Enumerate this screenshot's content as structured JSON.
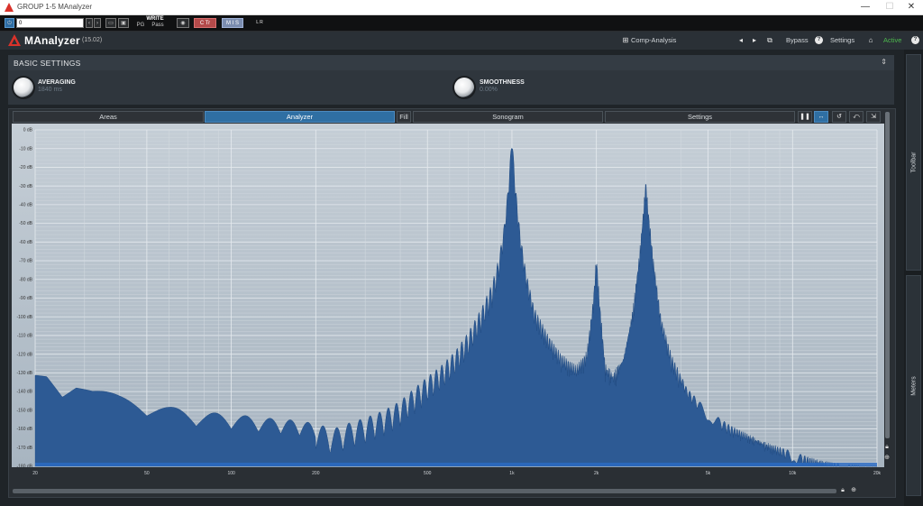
{
  "window": {
    "title": "GROUP 1-5 MAnalyzer",
    "minimize": "—",
    "maximize": "☐",
    "close": "✕"
  },
  "host_toolbar": {
    "preset_value": "0",
    "write_label": "WRITE",
    "pg_label": "PG",
    "pass_label": "Pass",
    "ctr_label": "C Tr",
    "mix_label": "M I S",
    "lr_label": "L R"
  },
  "header": {
    "plugin_name": "MAnalyzer",
    "version": "(15.02)",
    "preset_name": "Comp-Analysis",
    "bypass_label": "Bypass",
    "settings_label": "Settings",
    "active_label": "Active",
    "help_icon": "?",
    "home_icon": "⌂",
    "prev_icon": "◂",
    "next_icon": "▸",
    "random_icon": "⧉",
    "info_icon": "❶",
    "accent_color": "#4db84d"
  },
  "basic_settings": {
    "title": "BASIC SETTINGS",
    "averaging_label": "AVERAGING",
    "averaging_value": "1840 ms",
    "smoothness_label": "SMOOTHNESS",
    "smoothness_value": "0.00%"
  },
  "analyzer_tabs": {
    "areas": "Areas",
    "analyzer": "Analyzer",
    "fill": "Fill",
    "sonogram": "Sonogram",
    "settings": "Settings"
  },
  "analyzer_tools": {
    "pause": "❚❚",
    "range": "↔",
    "reset": "↺",
    "undo": "⤺",
    "export": "⇲"
  },
  "side_panel": {
    "toolbar_label": "Toolbar",
    "meters_label": "Meters"
  },
  "chart_data": {
    "type": "area",
    "x_scale": "log",
    "xlim": [
      20,
      20000
    ],
    "ylim": [
      -180,
      0
    ],
    "y_ticks": [
      "0 dB",
      "-10 dB",
      "-20 dB",
      "-30 dB",
      "-40 dB",
      "-50 dB",
      "-60 dB",
      "-70 dB",
      "-80 dB",
      "-90 dB",
      "-100 dB",
      "-110 dB",
      "-120 dB",
      "-130 dB",
      "-140 dB",
      "-150 dB",
      "-160 dB",
      "-170 dB",
      "-180 dB"
    ],
    "x_ticks": [
      {
        "freq": 20,
        "label": "20"
      },
      {
        "freq": 50,
        "label": "50"
      },
      {
        "freq": 100,
        "label": "100"
      },
      {
        "freq": 200,
        "label": "200"
      },
      {
        "freq": 500,
        "label": "500"
      },
      {
        "freq": 1000,
        "label": "1k"
      },
      {
        "freq": 2000,
        "label": "2k"
      },
      {
        "freq": 5000,
        "label": "5k"
      },
      {
        "freq": 10000,
        "label": "10k"
      },
      {
        "freq": 20000,
        "label": "20k"
      }
    ],
    "peaks": [
      {
        "freq": 1000,
        "db": 0
      },
      {
        "freq": 2000,
        "db": -66
      },
      {
        "freq": 3000,
        "db": -25
      }
    ],
    "spectrum": [
      [
        20,
        -128
      ],
      [
        22,
        -127
      ],
      [
        25,
        -135
      ],
      [
        28,
        -133
      ],
      [
        32,
        -138
      ],
      [
        36,
        -140
      ],
      [
        40,
        -142
      ],
      [
        50,
        -145
      ],
      [
        60,
        -148
      ],
      [
        70,
        -150
      ],
      [
        80,
        -151
      ],
      [
        100,
        -152
      ],
      [
        130,
        -154
      ],
      [
        160,
        -155
      ],
      [
        200,
        -157
      ],
      [
        230,
        -160
      ],
      [
        260,
        -157
      ],
      [
        300,
        -154
      ],
      [
        350,
        -150
      ],
      [
        400,
        -145
      ],
      [
        450,
        -138
      ],
      [
        500,
        -132
      ],
      [
        560,
        -126
      ],
      [
        630,
        -118
      ],
      [
        700,
        -108
      ],
      [
        780,
        -95
      ],
      [
        850,
        -82
      ],
      [
        900,
        -68
      ],
      [
        940,
        -50
      ],
      [
        970,
        -30
      ],
      [
        990,
        -12
      ],
      [
        1000,
        0
      ],
      [
        1010,
        -12
      ],
      [
        1030,
        -30
      ],
      [
        1070,
        -55
      ],
      [
        1120,
        -75
      ],
      [
        1200,
        -95
      ],
      [
        1350,
        -110
      ],
      [
        1500,
        -120
      ],
      [
        1700,
        -126
      ],
      [
        1850,
        -118
      ],
      [
        1950,
        -90
      ],
      [
        2000,
        -66
      ],
      [
        2050,
        -90
      ],
      [
        2150,
        -125
      ],
      [
        2300,
        -130
      ],
      [
        2500,
        -120
      ],
      [
        2700,
        -95
      ],
      [
        2850,
        -65
      ],
      [
        2950,
        -40
      ],
      [
        3000,
        -25
      ],
      [
        3050,
        -40
      ],
      [
        3200,
        -70
      ],
      [
        3400,
        -100
      ],
      [
        3700,
        -120
      ],
      [
        4200,
        -138
      ],
      [
        5000,
        -150
      ],
      [
        6000,
        -158
      ],
      [
        7000,
        -163
      ],
      [
        8000,
        -167
      ],
      [
        10000,
        -172
      ],
      [
        12000,
        -176
      ],
      [
        14000,
        -178
      ],
      [
        16000,
        -179
      ],
      [
        20000,
        -180
      ]
    ]
  }
}
